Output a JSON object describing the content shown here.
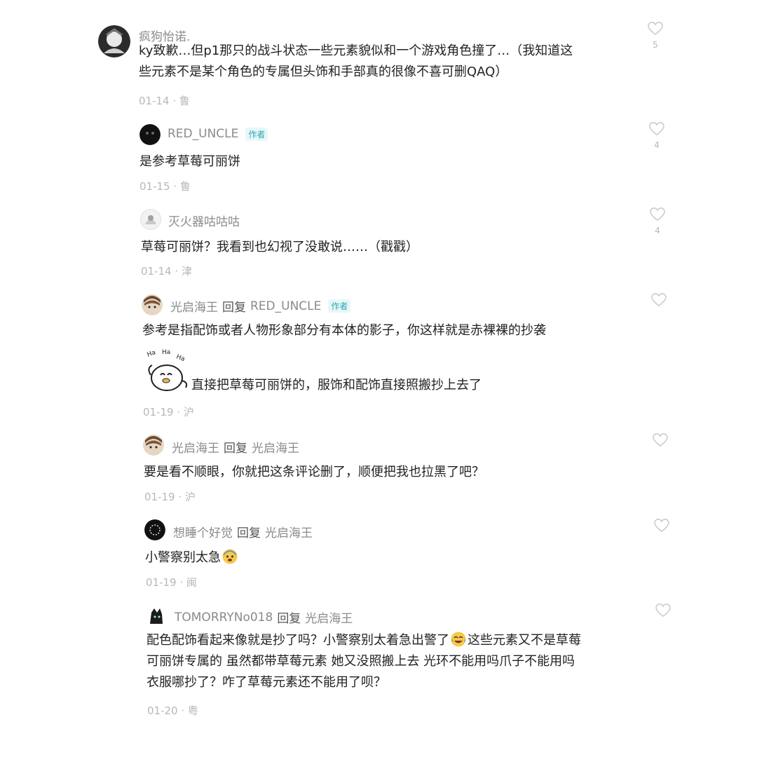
{
  "comments": [
    {
      "username": "疯狗怡诺.",
      "lines": [
        "ky致歉…但p1那只的战斗状态一些元素貌似和一个游戏角色撞了…（我知道这",
        "些元素不是某个角色的专属但头饰和手部真的很像不喜可删QAQ）"
      ],
      "meta": "01-14 · 鲁",
      "likes": "5"
    },
    {
      "username": "RED_UNCLE",
      "badge": "作者",
      "lines": [
        "是参考草莓可丽饼"
      ],
      "meta": "01-15 · 鲁",
      "likes": "4"
    },
    {
      "username": "灭火器咕咕咕",
      "lines": [
        "草莓可丽饼？我看到也幻视了没敢说……（戳戳）"
      ],
      "meta": "01-14 · 津",
      "likes": "4"
    },
    {
      "username": "光启海王",
      "reply_word": "回复",
      "reply_to": "RED_UNCLE",
      "badge": "作者",
      "lines": [
        "参考是指配饰或者人物形象部分有本体的影子，你这样就是赤裸裸的抄袭"
      ],
      "line2": "直接把草莓可丽饼的，服饰和配饰直接照搬抄上去了",
      "sticker_text": [
        "Ha",
        "Ha",
        "Ha"
      ],
      "meta": "01-19 · 沪"
    },
    {
      "username": "光启海王",
      "reply_word": "回复",
      "reply_to": "光启海王",
      "lines": [
        "要是看不顺眼，你就把这条评论删了，顺便把我也拉黑了吧？"
      ],
      "meta": "01-19 · 沪"
    },
    {
      "username": "想睡个好觉",
      "reply_word": "回复",
      "reply_to": "光启海王",
      "lines": [
        "小警察别太急"
      ],
      "meta": "01-19 · 闽"
    },
    {
      "username": "TOMORRYNo018",
      "reply_word": "回复",
      "reply_to": "光启海王",
      "line1a": "配色配饰看起来像就是抄了吗？小警察别太着急出警了",
      "line1b": "这些元素又不是草莓",
      "lines_rest": [
        "可丽饼专属的 虽然都带草莓元素 她又没照搬上去 光环不能用吗爪子不能用吗",
        "衣服哪抄了？咋了草莓元素还不能用了呗？"
      ],
      "meta": "01-20 · 粤"
    }
  ],
  "icons": {
    "like": "heart-outline-icon"
  },
  "colors": {
    "meta": "#b8b8b8",
    "username": "#8a8a8a",
    "badge": "#2aa6b0"
  }
}
